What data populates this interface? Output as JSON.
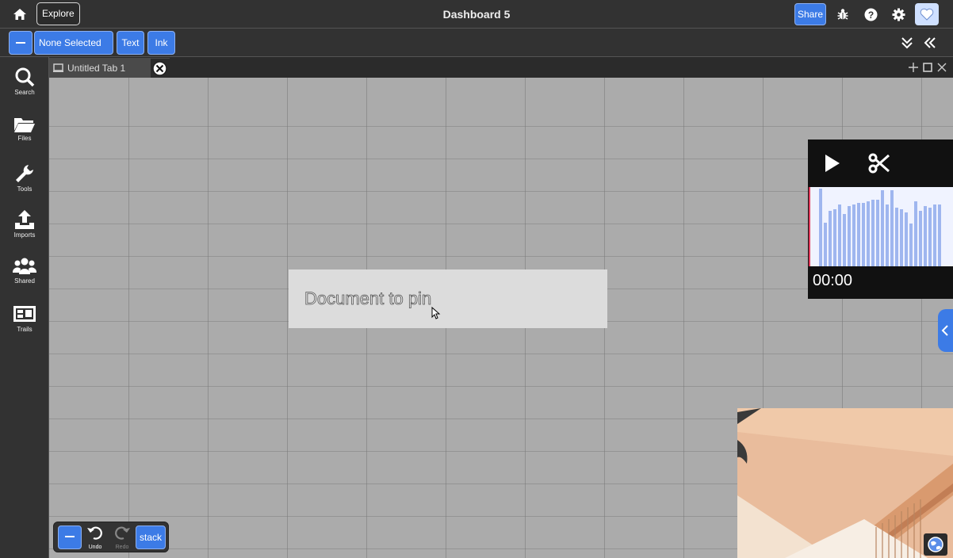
{
  "header": {
    "explore_label": "Explore",
    "title": "Dashboard 5",
    "share_label": "Share",
    "icons": [
      "home-icon",
      "bug-icon",
      "help-icon",
      "gear-icon",
      "heart-icon"
    ]
  },
  "toolbar": {
    "selection_label": "None Selected",
    "text_label": "Text",
    "ink_label": "Ink"
  },
  "sidebar": {
    "items": [
      {
        "label": "Search",
        "icon": "search-icon"
      },
      {
        "label": "Files",
        "icon": "folder-icon"
      },
      {
        "label": "Tools",
        "icon": "wrench-icon"
      },
      {
        "label": "Imports",
        "icon": "upload-icon"
      },
      {
        "label": "Shared",
        "icon": "users-icon"
      },
      {
        "label": "Trails",
        "icon": "trails-icon"
      }
    ]
  },
  "tabs": [
    {
      "label": "Untitled Tab 1"
    }
  ],
  "canvas": {
    "document_text": "Document to pin"
  },
  "audio": {
    "time": "00:00",
    "waveform_levels": [
      0.98,
      0.55,
      0.7,
      0.72,
      0.78,
      0.66,
      0.76,
      0.78,
      0.8,
      0.8,
      0.82,
      0.84,
      0.84,
      0.96,
      0.78,
      0.96,
      0.74,
      0.72,
      0.68,
      0.54,
      0.82,
      0.7,
      0.76,
      0.74,
      0.78,
      0.78
    ]
  },
  "bottom_toolbar": {
    "undo_label": "Undo",
    "redo_label": "Redo",
    "stack_label": "stack"
  },
  "colors": {
    "accent": "#3c7be6",
    "panel": "#323232",
    "canvas": "#ababab"
  }
}
